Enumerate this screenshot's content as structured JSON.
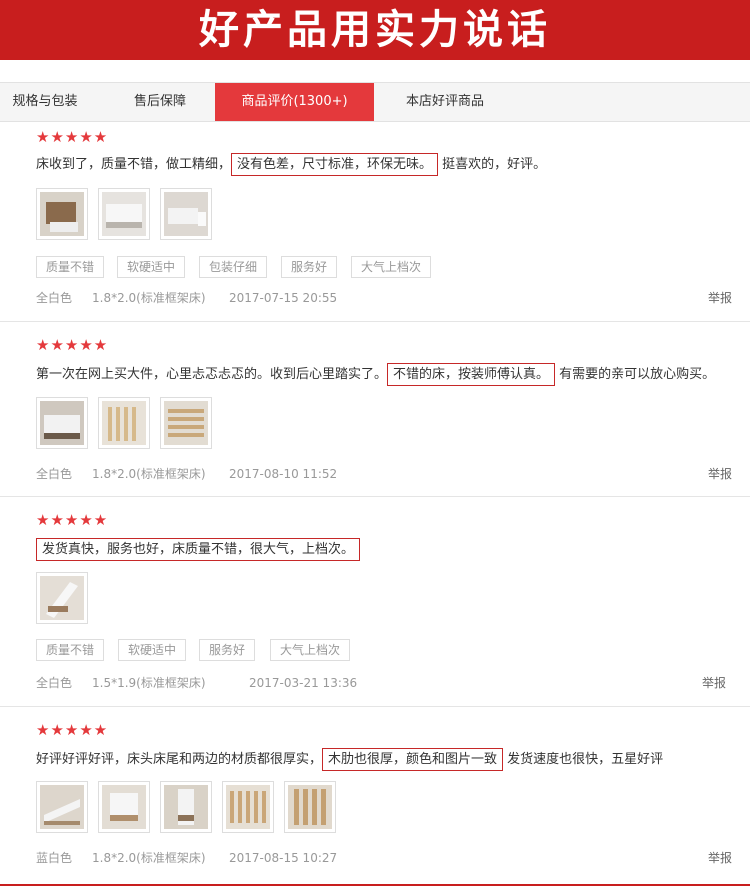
{
  "banner": {
    "title": "好产品用实力说话",
    "color": "#c81e1e"
  },
  "tabs": [
    {
      "label": "规格与包装",
      "active": false
    },
    {
      "label": "售后保障",
      "active": false
    },
    {
      "label": "商品评价(1300+)",
      "active": true
    },
    {
      "label": "本店好评商品",
      "active": false
    }
  ],
  "reviews": [
    {
      "rating": 5,
      "text_before": "床收到了，质量不错，做工精细，",
      "text_highlight": "没有色差，尺寸标准，环保无味。",
      "text_after": "挺喜欢的，好评。",
      "tags": [
        "质量不错",
        "软硬适中",
        "包装仔细",
        "服务好",
        "大气上档次"
      ],
      "color": "全白色",
      "size": "1.8*2.0(标准框架床)",
      "date": "2017-07-15 20:55",
      "report": "举报"
    },
    {
      "rating": 5,
      "text_before": "第一次在网上买大件，心里忐忑忐忑的。收到后心里踏实了。",
      "text_highlight": "不错的床，按装师傅认真。",
      "text_after": "有需要的亲可以放心购买。",
      "tags": [],
      "color": "全白色",
      "size": "1.8*2.0(标准框架床)",
      "date": "2017-08-10 11:52",
      "report": "举报"
    },
    {
      "rating": 5,
      "text_before": "",
      "text_highlight": "发货真快，服务也好，床质量不错，很大气，上档次。",
      "text_after": "",
      "tags": [
        "质量不错",
        "软硬适中",
        "服务好",
        "大气上档次"
      ],
      "color": "全白色",
      "size": "1.5*1.9(标准框架床)",
      "date": "2017-03-21 13:36",
      "report": "举报"
    },
    {
      "rating": 5,
      "text_before": "好评好评好评，床头床尾和两边的材质都很厚实，",
      "text_highlight": "木肋也很厚，颜色和图片一致",
      "text_after": "发货速度也很快，五星好评",
      "tags": [],
      "color": "蓝白色",
      "size": "1.8*2.0(标准框架床)",
      "date": "2017-08-15 10:27",
      "report": "举报"
    }
  ]
}
